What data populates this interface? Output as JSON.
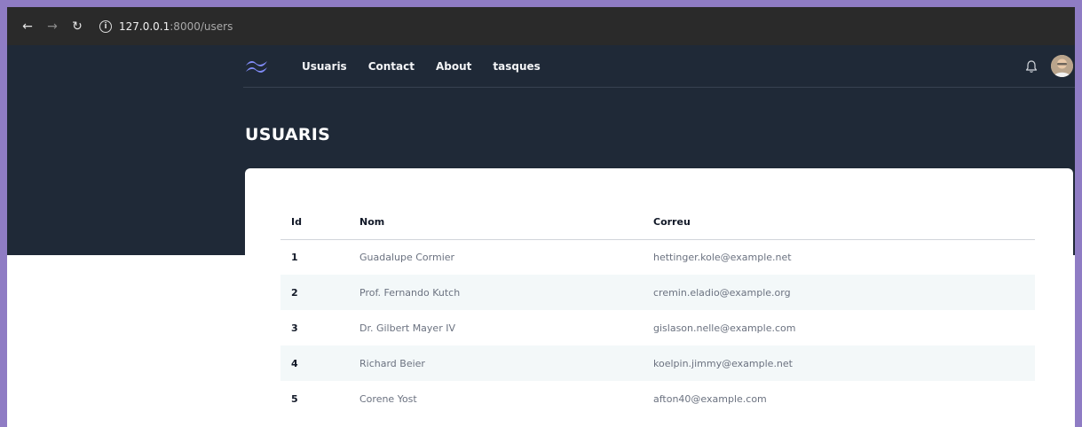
{
  "browser": {
    "url_host": "127.0.0.1",
    "url_path": ":8000/users"
  },
  "nav": {
    "links": [
      "Usuaris",
      "Contact",
      "About",
      "tasques"
    ]
  },
  "page": {
    "title": "USUARIS"
  },
  "table": {
    "headers": [
      "Id",
      "Nom",
      "Correu"
    ],
    "rows": [
      {
        "id": "1",
        "nom": "Guadalupe Cormier",
        "correu": "hettinger.kole@example.net"
      },
      {
        "id": "2",
        "nom": "Prof. Fernando Kutch",
        "correu": "cremin.eladio@example.org"
      },
      {
        "id": "3",
        "nom": "Dr. Gilbert Mayer IV",
        "correu": "gislason.nelle@example.com"
      },
      {
        "id": "4",
        "nom": "Richard Beier",
        "correu": "koelpin.jimmy@example.net"
      },
      {
        "id": "5",
        "nom": "Corene Yost",
        "correu": "afton40@example.com"
      }
    ]
  },
  "colors": {
    "accent": "#818cf8",
    "header_bg": "#1f2937"
  }
}
